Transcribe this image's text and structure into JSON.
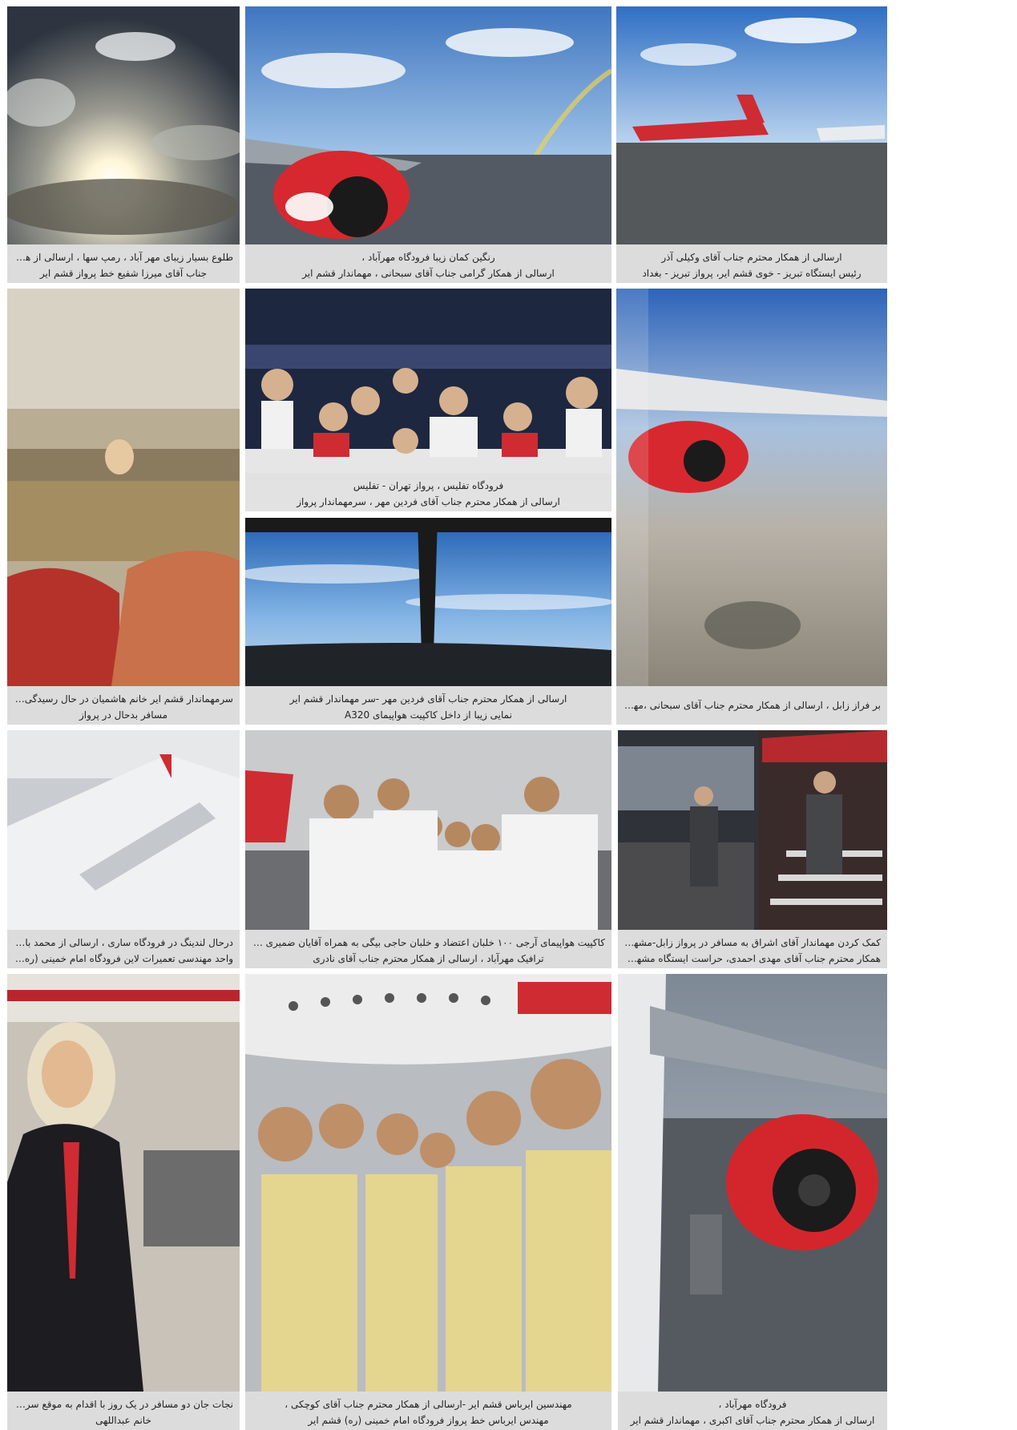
{
  "gallery": {
    "t1": {
      "icon": "sunrise-photo",
      "lines": [
        "طلوع بسیار زیبای مهر آباد ، رمپ سها ، ارسالی از همکار محترم",
        "جناب آقای میرزا شفیع خط پرواز قشم ایر"
      ]
    },
    "t2": {
      "icon": "rainbow-airport-photo",
      "lines": [
        "رنگین کمان زیبا فرودگاه مهرآباد ،",
        "ارسالی از همکار گرامی جناب آقای سبحانی ، مهماندار قشم ایر"
      ]
    },
    "t3": {
      "icon": "apron-aircraft-photo",
      "lines": [
        "ارسالی از همکار محترم جناب آقای وکیلی آذر",
        "رئیس ایستگاه تبریز - خوی قشم ایر، پرواز تبریز - بغداد"
      ]
    },
    "t4": {
      "icon": "cabin-photo",
      "lines": [
        "سرمهماندار قشم ایر خانم هاشمیان در حال رسیدگی و دلداری به",
        "مسافر بدحال در پرواز"
      ]
    },
    "t5": {
      "icon": "crew-group-photo",
      "lines": [
        "فرودگاه تفلیس ، پرواز تهران - تفلیس",
        "ارسالی از همکار محترم جناب آقای فردین مهر ، سرمهماندار پرواز"
      ]
    },
    "t6": {
      "icon": "wing-engine-aerial-photo",
      "lines": [
        "بر فراز زابل ، ارسالی از همکار محترم جناب آقای سبحانی ،مهماندار قشم ایر"
      ]
    },
    "t7": {
      "icon": "cockpit-photo",
      "lines": [
        "ارسالی از همکار محترم جناب آقای فردین مهر -سر مهماندار  قشم ایر",
        "نمایی زیبا از داخل کاکپیت هواپیمای A320"
      ]
    },
    "t8": {
      "icon": "wing-flaps-photo",
      "lines": [
        "درحال لندینگ در فرودگاه ساری ، ارسالی از محمد باجلان همکار",
        "واحد مهندسی تعمیرات لاین فرودگاه امام خمینی (ره) قشم ایر"
      ]
    },
    "t9": {
      "icon": "pilots-group-photo",
      "lines": [
        "کاکپیت هواپیمای آرجی ۱۰۰ خلبان اعتضاد و خلبان حاجی بیگی به همراه  آقایان ضمیری و نادری ،پرسنل",
        "ترافیک مهرآباد ، ارسالی از همکار محترم جناب آقای نادری"
      ]
    },
    "t10": {
      "icon": "passenger-assist-photo",
      "lines": [
        "کمک کردن مهماندار آقای اشراق به مسافر در پرواز زابل-مشهد-ارسالی از",
        "همکار محترم جناب آقای مهدی احمدی، حراست ایستگاه مشهد قشم ایر"
      ]
    },
    "t11": {
      "icon": "flight-attendant-photo",
      "lines": [
        "نجات جان دو مسافر  در یک روز با اقدام به موقع سرمهماندار پرواز",
        "خانم عبداللهی"
      ]
    },
    "t12": {
      "icon": "engineers-selfie-photo",
      "lines": [
        "مهندسین ایرباس قشم ایر -ارسالی از همکار محترم جناب آقای کوچکی ،",
        "مهندس ایرباس خط پرواز فرودگاه امام خمینی (ره) قشم ایر"
      ]
    },
    "t13": {
      "icon": "engine-closeup-photo",
      "lines": [
        "فرودگاه مهرآباد ،",
        "ارسالی از همکار محترم جناب آقای اکبری ، مهماندار قشم ایر"
      ]
    }
  }
}
